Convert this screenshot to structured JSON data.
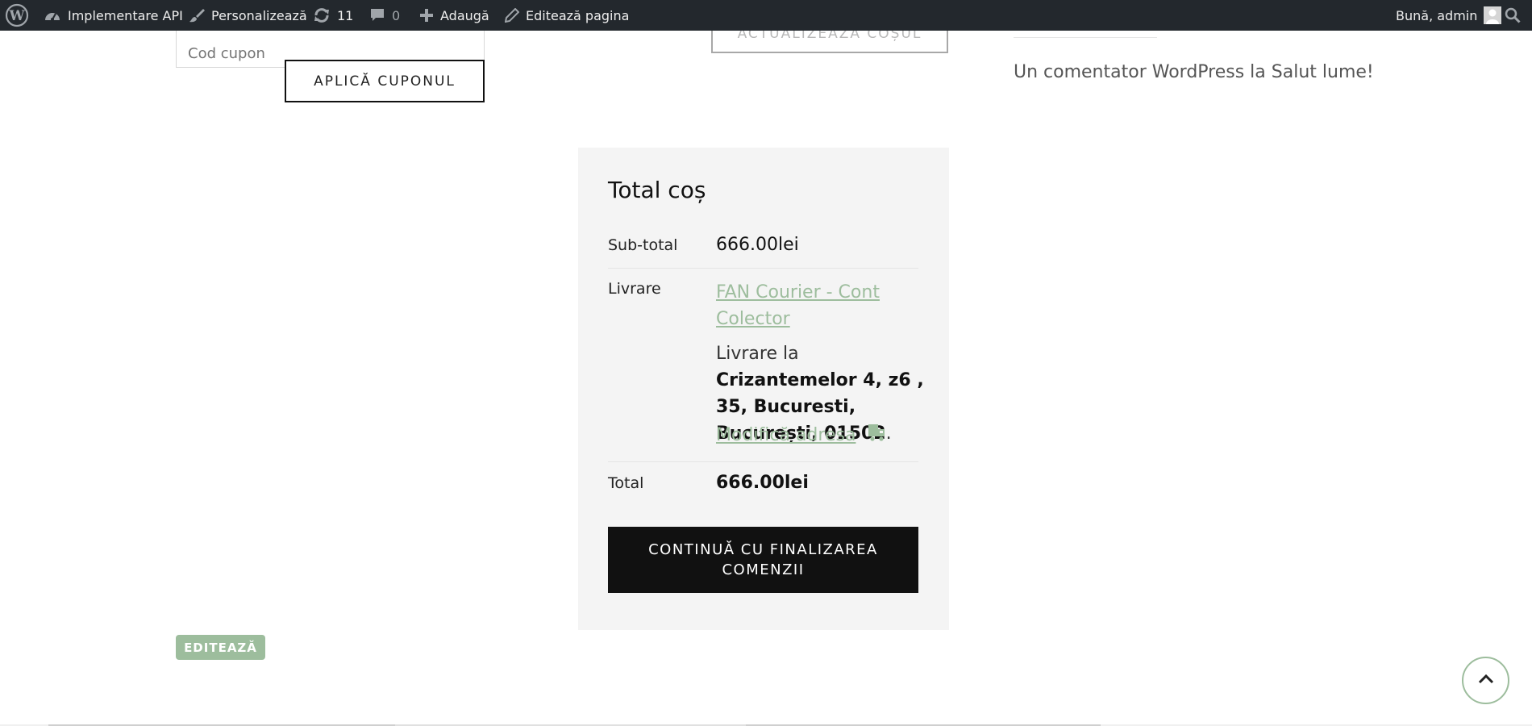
{
  "adminbar": {
    "site_name": "Implementare API",
    "customize": "Personalizează",
    "updates_count": "11",
    "comments_count": "0",
    "new": "Adaugă",
    "edit_page": "Editează pagina",
    "greeting": "Bună, admin",
    "icons": [
      "wordpress-icon",
      "dashboard-icon",
      "brush-icon",
      "refresh-icon",
      "comment-icon",
      "plus-icon",
      "pencil-icon",
      "avatar",
      "search-icon"
    ]
  },
  "coupon": {
    "placeholder": "Cod cupon",
    "apply_label": "APLICĂ CUPONUL",
    "update_cart_label": "ACTUALIZEAZĂ COȘUL"
  },
  "sidebar": {
    "recent_comment": "Un comentator WordPress la Salut lume!"
  },
  "cart_totals": {
    "title": "Total coș",
    "subtotal_label": "Sub-total",
    "subtotal_value": "666.00lei",
    "shipping_label": "Livrare",
    "shipping_method": "FAN Courier - Cont Colector",
    "shipping_to_prefix": "Livrare la",
    "shipping_address": "Crizantemelor 4, z6 , 35, Bucuresti, București, 01502",
    "shipping_to_suffix": ".",
    "change_address": "Modifică adresa",
    "total_label": "Total",
    "total_value": "666.00lei",
    "checkout_label": "CONTINUĂ CU FINALIZAREA COMENZII"
  },
  "edit_badge": "EDITEAZĂ",
  "colors": {
    "adminbar_bg": "#23282d",
    "accent_green": "#9dbd9d",
    "checkout_bg": "#111111",
    "totals_bg": "#f4f4f4"
  }
}
